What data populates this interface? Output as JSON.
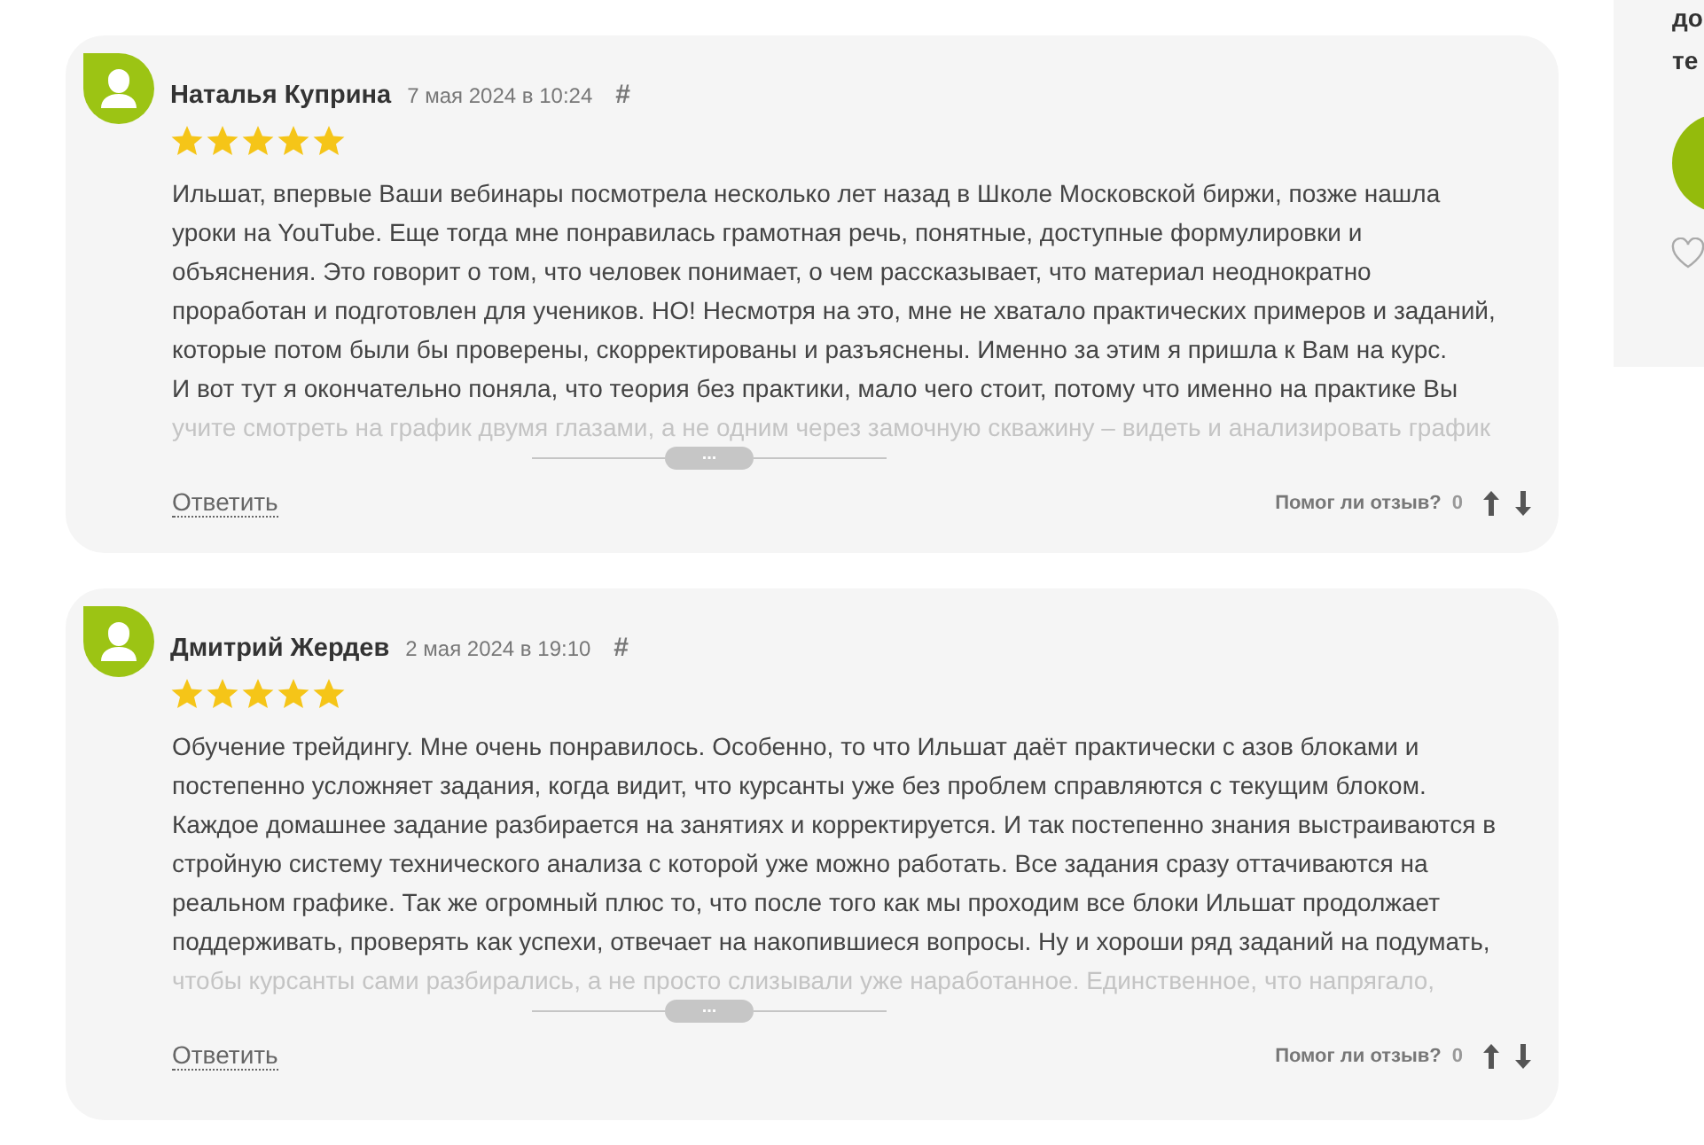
{
  "reviews": [
    {
      "author": "Наталья Куприна",
      "date": "7 мая 2024 в 10:24",
      "anchor": "#",
      "stars": 5,
      "lines": [
        "Ильшат, впервые Ваши вебинары посмотрела несколько лет назад в Школе Московской биржи, позже нашла",
        "уроки на YouTube. Еще тогда мне понравилась грамотная речь, понятные, доступные формулировки и",
        "объяснения. Это говорит о том, что человек понимает, о чем рассказывает, что материал неоднократно",
        "проработан и подготовлен для учеников. НО! Несмотря на это, мне не хватало практических примеров и заданий,",
        "которые потом были бы проверены, скорректированы и разъяснены. Именно за этим я пришла к Вам на курс.",
        "И вот тут я окончательно поняла, что теория без практики, мало чего стоит, потому что именно на практике Вы"
      ],
      "faded_line": "учите смотреть на график двумя глазами, а не одним через замочную скважину – видеть и анализировать график",
      "expand_label": "...",
      "reply": "Ответить",
      "helpful_label": "Помог ли отзыв?",
      "helpful_count": "0"
    },
    {
      "author": "Дмитрий Жердев",
      "date": "2 мая 2024 в 19:10",
      "anchor": "#",
      "stars": 5,
      "lines": [
        "Обучение трейдингу. Мне очень понравилось. Особенно, то что Ильшат даёт практически с азов блоками и",
        "постепенно усложняет задания, когда видит, что курсанты уже без проблем справляются с текущим блоком.",
        "Каждое домашнее задание разбирается на занятиях и корректируется. И так постепенно знания выстраиваются в",
        "стройную систему технического анализа с которой уже можно работать. Все задания сразу оттачиваются на",
        "реальном графике. Так же огромный плюс то, что после того как мы проходим все блоки Ильшат продолжает",
        "поддерживать, проверять как успехи, отвечает на накопившиеся вопросы. Ну и хороши ряд заданий на подумать,"
      ],
      "faded_line": "чтобы курсанты сами разбирались, а не просто слизывали уже наработанное. Единственное, что напрягало,",
      "expand_label": "...",
      "reply": "Ответить",
      "helpful_label": "Помог ли отзыв?",
      "helpful_count": "0"
    }
  ],
  "sidebar": {
    "lines": [
      "до",
      "те"
    ]
  }
}
